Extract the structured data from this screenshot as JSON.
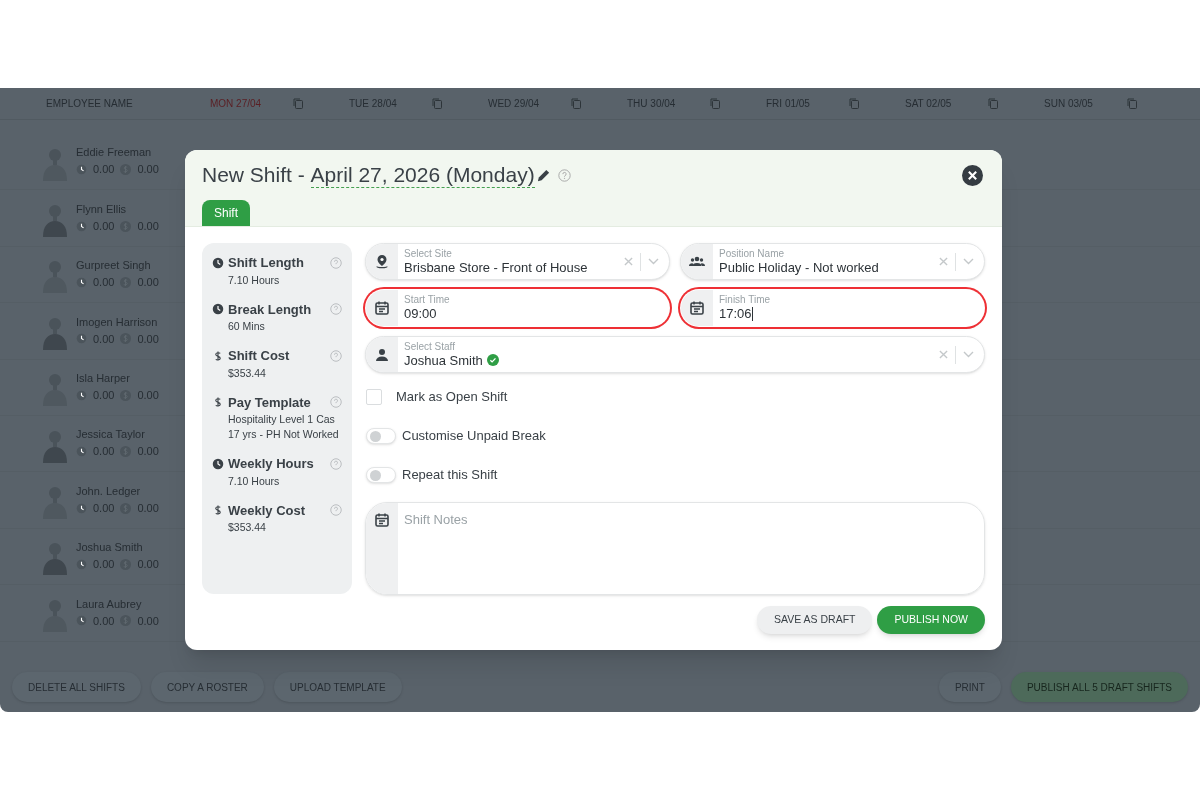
{
  "roster": {
    "columns": [
      {
        "label": "EMPLOYEE NAME",
        "today": false
      },
      {
        "label": "MON 27/04",
        "today": true
      },
      {
        "label": "TUE 28/04",
        "today": false
      },
      {
        "label": "WED 29/04",
        "today": false
      },
      {
        "label": "THU 30/04",
        "today": false
      },
      {
        "label": "FRI 01/05",
        "today": false
      },
      {
        "label": "SAT 02/05",
        "today": false
      },
      {
        "label": "SUN 03/05",
        "today": false
      }
    ],
    "employees": [
      {
        "name": "Eddie Freeman",
        "hours": "0.00",
        "cost": "0.00"
      },
      {
        "name": "Flynn Ellis",
        "hours": "0.00",
        "cost": "0.00"
      },
      {
        "name": "Gurpreet Singh",
        "hours": "0.00",
        "cost": "0.00"
      },
      {
        "name": "Imogen Harrison",
        "hours": "0.00",
        "cost": "0.00"
      },
      {
        "name": "Isla Harper",
        "hours": "0.00",
        "cost": "0.00"
      },
      {
        "name": "Jessica Taylor",
        "hours": "0.00",
        "cost": "0.00"
      },
      {
        "name": "John. Ledger",
        "hours": "0.00",
        "cost": "0.00"
      },
      {
        "name": "Joshua Smith",
        "hours": "0.00",
        "cost": "0.00"
      },
      {
        "name": "Laura Aubrey",
        "hours": "0.00",
        "cost": "0.00"
      }
    ],
    "footer_left": [
      "DELETE ALL SHIFTS",
      "COPY A ROSTER",
      "UPLOAD TEMPLATE"
    ],
    "footer_right": [
      {
        "label": "PRINT",
        "kind": "plain"
      },
      {
        "label": "PUBLISH ALL 5 DRAFT SHIFTS",
        "kind": "primary"
      }
    ]
  },
  "modal": {
    "title": "New Shift - ",
    "date": "April 27, 2026 (Monday)",
    "tabs": [
      {
        "label": "Shift",
        "selected": true
      }
    ],
    "summary": [
      {
        "kind": "time",
        "label": "Shift Length",
        "lines": [
          "7.10 Hours"
        ]
      },
      {
        "kind": "time",
        "label": "Break Length",
        "lines": [
          "60 Mins"
        ]
      },
      {
        "kind": "money",
        "label": "Shift Cost",
        "lines": [
          "$353.44"
        ]
      },
      {
        "kind": "money",
        "label": "Pay Template",
        "lines": [
          "Hospitality Level 1 Cas",
          "17 yrs - PH Not Worked"
        ]
      },
      {
        "kind": "time",
        "label": "Weekly Hours",
        "lines": [
          "7.10 Hours"
        ]
      },
      {
        "kind": "money",
        "label": "Weekly Cost",
        "lines": [
          "$353.44"
        ]
      }
    ],
    "fields": [
      {
        "kind": "select",
        "label": "Select Site",
        "value": "Brisbane Store - Front of House",
        "highlighted": false,
        "verified": false,
        "wide": false
      },
      {
        "kind": "select",
        "label": "Position Name",
        "value": "Public Holiday - Not worked",
        "highlighted": false,
        "verified": false,
        "wide": false
      },
      {
        "kind": "time",
        "label": "Start Time",
        "value": "09:00",
        "highlighted": true,
        "verified": false,
        "wide": false
      },
      {
        "kind": "time",
        "label": "Finish Time",
        "value": "17:06",
        "highlighted": true,
        "verified": false,
        "wide": false
      },
      {
        "kind": "select",
        "label": "Select Staff",
        "value": "Joshua Smith",
        "highlighted": false,
        "verified": true,
        "wide": true
      }
    ],
    "options": [
      {
        "kind": "checkbox",
        "label": "Mark as Open Shift",
        "on": false
      },
      {
        "kind": "toggle",
        "label": "Customise Unpaid Break",
        "on": false
      },
      {
        "kind": "toggle",
        "label": "Repeat this Shift",
        "on": false
      }
    ],
    "notes": {
      "placeholder": "Shift Notes"
    },
    "buttons": [
      {
        "label": "SAVE AS DRAFT",
        "kind": "plain"
      },
      {
        "label": "PUBLISH NOW",
        "kind": "primary"
      }
    ]
  }
}
